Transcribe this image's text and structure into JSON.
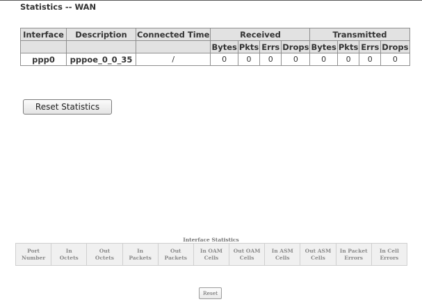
{
  "page": {
    "title": "Statistics -- WAN"
  },
  "wan_table": {
    "headers": {
      "interface": "Interface",
      "description": "Description",
      "connected_time": "Connected Time",
      "received": "Received",
      "transmitted": "Transmitted"
    },
    "sub_headers": {
      "received": [
        "Bytes",
        "Pkts",
        "Errs",
        "Drops"
      ],
      "transmitted": [
        "Bytes",
        "Pkts",
        "Errs",
        "Drops"
      ]
    },
    "rows": [
      {
        "interface": "ppp0",
        "description": "pppoe_0_0_35",
        "connected_time": "/",
        "received": [
          "0",
          "0",
          "0",
          "0"
        ],
        "transmitted": [
          "0",
          "0",
          "0",
          "0"
        ]
      }
    ]
  },
  "actions": {
    "reset_statistics": "Reset Statistics"
  },
  "interface_stats": {
    "caption": "Interface Statistics",
    "headers": [
      [
        "Port",
        "Number"
      ],
      [
        "In",
        "Octets"
      ],
      [
        "Out",
        "Octets"
      ],
      [
        "In",
        "Packets"
      ],
      [
        "Out",
        "Packets"
      ],
      [
        "In OAM",
        "Cells"
      ],
      [
        "Out OAM",
        "Cells"
      ],
      [
        "In ASM",
        "Cells"
      ],
      [
        "Out ASM",
        "Cells"
      ],
      [
        "In Packet",
        "Errors"
      ],
      [
        "In Cell",
        "Errors"
      ]
    ],
    "reset_label": "Reset"
  }
}
